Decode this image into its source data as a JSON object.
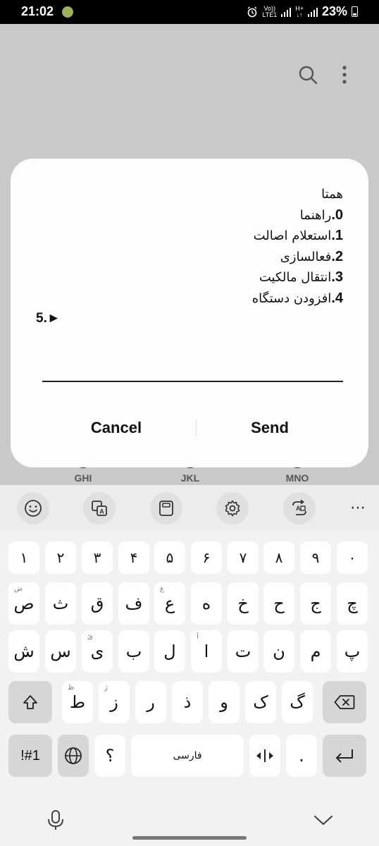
{
  "status_bar": {
    "time": "21:02",
    "volte": "Vo))",
    "lte": "LTE1",
    "net_type": "H+",
    "battery": "23%"
  },
  "background_app": {
    "dial_keys": [
      "GHI",
      "JKL",
      "MNO"
    ]
  },
  "dialog": {
    "lines": [
      {
        "num": "",
        "text": "همتا"
      },
      {
        "num": "0.",
        "text": "راهنما"
      },
      {
        "num": "1.",
        "text": "استعلام اصالت"
      },
      {
        "num": "2.",
        "text": "فعالسازی"
      },
      {
        "num": "3.",
        "text": "انتقال مالکیت"
      },
      {
        "num": "4.",
        "text": "افزودن دستگاه"
      }
    ],
    "prompt": "5.►",
    "input_value": "",
    "cancel_label": "Cancel",
    "send_label": "Send"
  },
  "keyboard": {
    "toolbar_icons": [
      "emoji-icon",
      "translate-icon",
      "clipboard-icon",
      "settings-icon",
      "mode-switch-icon",
      "more-icon"
    ],
    "number_row": [
      "۱",
      "۲",
      "۳",
      "۴",
      "۵",
      "۶",
      "۷",
      "۸",
      "۹",
      "۰"
    ],
    "row1": [
      "ص",
      "ث",
      "ق",
      "ف",
      "ع",
      "ه",
      "خ",
      "ح",
      "ج",
      "چ"
    ],
    "row1_hints": [
      "ض",
      "",
      "",
      "",
      "غ",
      "",
      "",
      "",
      "",
      ""
    ],
    "row2": [
      "ش",
      "س",
      "ی",
      "ب",
      "ل",
      "ا",
      "ت",
      "ن",
      "م",
      "پ"
    ],
    "row2_hints": [
      "",
      "",
      "ئ",
      "",
      "",
      "آ",
      "",
      "",
      "",
      ""
    ],
    "row3": [
      "ط",
      "ز",
      "ر",
      "ذ",
      "و",
      "ک",
      "گ"
    ],
    "row3_hints": [
      "ظ",
      "ژ",
      "",
      "",
      "",
      "",
      ""
    ],
    "symbols_label": "!#1",
    "question_key": "؟",
    "space_label": "فارسی",
    "period_key": "."
  }
}
